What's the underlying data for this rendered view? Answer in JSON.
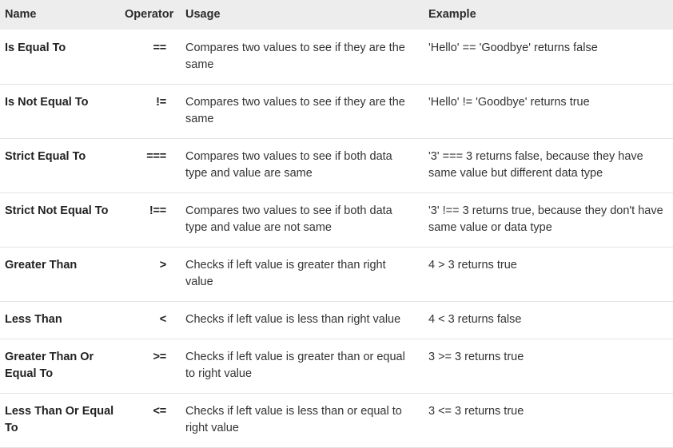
{
  "table": {
    "columns": [
      {
        "key": "name",
        "label": "Name"
      },
      {
        "key": "operator",
        "label": "Operator"
      },
      {
        "key": "usage",
        "label": "Usage"
      },
      {
        "key": "example",
        "label": "Example"
      }
    ],
    "header_background": "#ededed",
    "row_divider_color": "#e4e4e4",
    "text_color": "#333333",
    "rows": [
      {
        "name": "Is Equal To",
        "operator": "==",
        "usage": "Compares two values to see if they are the same",
        "example": "'Hello' == 'Goodbye' returns false"
      },
      {
        "name": "Is Not Equal To",
        "operator": "!=",
        "usage": "Compares two values to see if they are the same",
        "example": "'Hello' != 'Goodbye' returns true"
      },
      {
        "name": "Strict Equal To",
        "operator": "===",
        "usage": "Compares two values to see if both data type and value are same",
        "example": "'3' === 3 returns false, because they have same value but different data type"
      },
      {
        "name": "Strict Not Equal To",
        "operator": "!==",
        "usage": "Compares two values to see if both data type and value are not same",
        "example": "'3' !== 3 returns true, because they don't have same value or data type"
      },
      {
        "name": "Greater Than",
        "operator": ">",
        "usage": "Checks if left value is greater than right value",
        "example": "4 > 3 returns true"
      },
      {
        "name": "Less Than",
        "operator": "<",
        "usage": "Checks if left value is less than right value",
        "example": "4 < 3 returns false"
      },
      {
        "name": "Greater Than Or Equal To",
        "operator": ">=",
        "usage": "Checks if left value is greater than or equal to right value",
        "example": "3 >= 3 returns true"
      },
      {
        "name": "Less Than Or Equal To",
        "operator": "<=",
        "usage": "Checks if left value is less than or equal to right value",
        "example": "3 <= 3 returns true"
      }
    ]
  }
}
